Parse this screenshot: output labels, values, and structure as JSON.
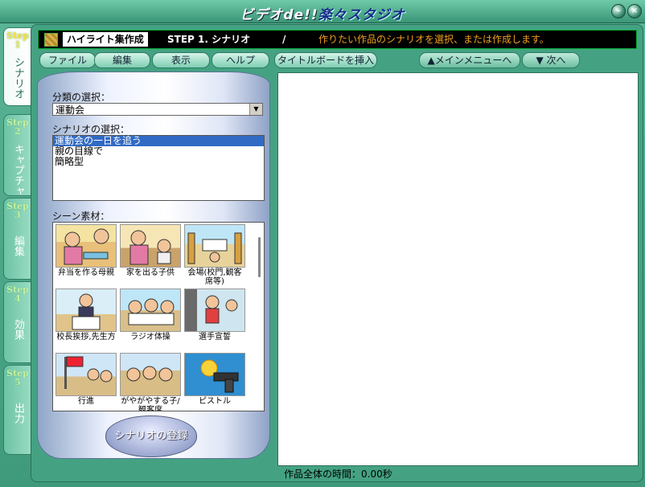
{
  "app": {
    "title_main": "ビデオde!!",
    "title_sub": "楽々スタジオ"
  },
  "steps": [
    {
      "num": "Step 1",
      "name": "シナリオ",
      "active": true
    },
    {
      "num": "Step 2",
      "name": "キャプチャ",
      "active": false
    },
    {
      "num": "Step 3",
      "name": "編集",
      "active": false
    },
    {
      "num": "Step 4",
      "name": "効果",
      "active": false
    },
    {
      "num": "Step 5",
      "name": "出力",
      "active": false
    }
  ],
  "header": {
    "mode_label": "ハイライト集作成",
    "step_label": "STEP 1.  シナリオ",
    "separator": "/",
    "description": "作りたい作品のシナリオを選択、または作成します。"
  },
  "toolbar": {
    "file": "ファイル",
    "edit": "編集",
    "view": "表示",
    "help": "ヘルプ",
    "insert_title": "タイトルボードを挿入",
    "main_menu": "メインメニューへ",
    "next": "次へ"
  },
  "left": {
    "category_label": "分類の選択：",
    "category_value": "運動会",
    "scenario_label": "シナリオの選択：",
    "scenarios": [
      "運動会の一日を追う",
      "親の目線で",
      "簡略型"
    ],
    "scene_label": "シーン素材：",
    "scenes": [
      "弁当を作る母親",
      "家を出る子供",
      "会場(校門,観客席等)",
      "校長挨拶,先生方",
      "ラジオ体操",
      "選手宣誓",
      "行進",
      "がやがやする子/観客席",
      "ピストル"
    ],
    "register_button": "シナリオの登録"
  },
  "footer": {
    "total_time_label": "作品全体の時間：",
    "total_time_value": "0.00秒"
  }
}
